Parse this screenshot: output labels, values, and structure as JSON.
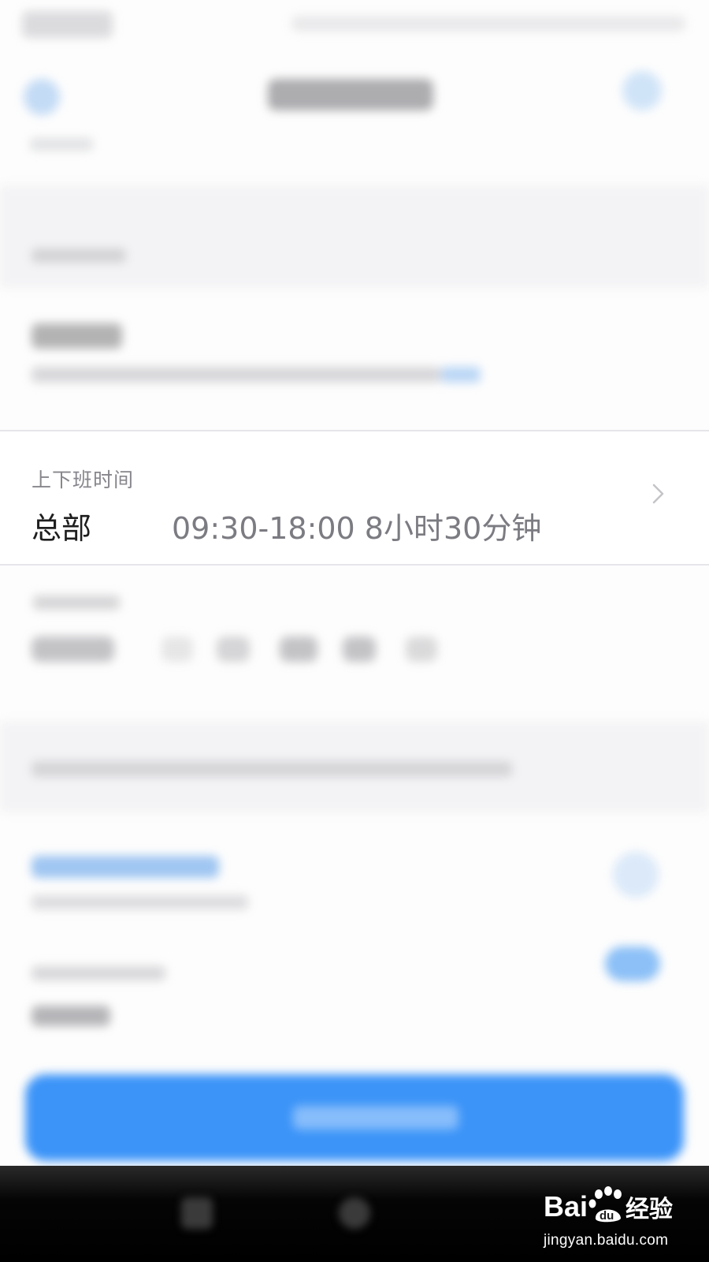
{
  "work_time": {
    "caption": "上下班时间",
    "location": "总部",
    "schedule": "09:30-18:00 8小时30分钟"
  },
  "watermark": {
    "brand": "Baidu经验",
    "url": "jingyan.baidu.com"
  },
  "colors": {
    "accent_blue": "#3c94f8",
    "text_primary": "#1e1e1e",
    "text_secondary": "#7b7b82"
  },
  "icons": {
    "row_chevron": "chevron-right-icon"
  }
}
